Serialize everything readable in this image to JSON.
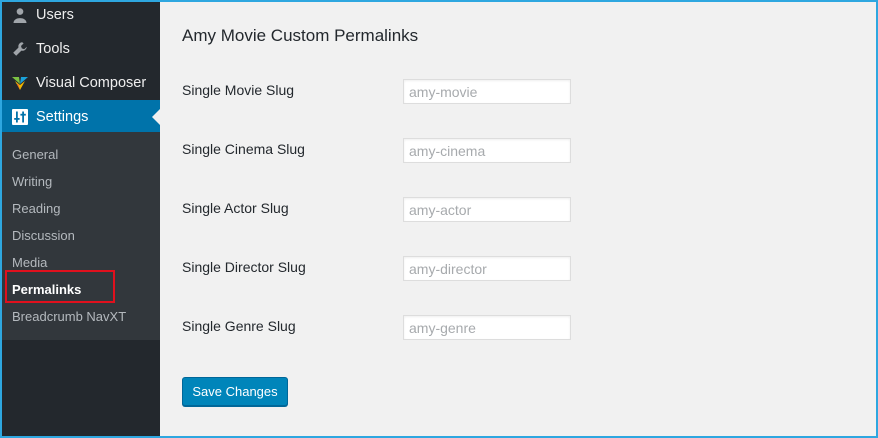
{
  "sidebar": {
    "menu": [
      {
        "label": "Users",
        "icon": "users-icon"
      },
      {
        "label": "Tools",
        "icon": "wrench-icon"
      },
      {
        "label": "Visual Composer",
        "icon": "visual-composer-icon"
      },
      {
        "label": "Settings",
        "icon": "settings-sliders-icon",
        "current": true
      }
    ],
    "submenu": [
      {
        "label": "General"
      },
      {
        "label": "Writing"
      },
      {
        "label": "Reading"
      },
      {
        "label": "Discussion"
      },
      {
        "label": "Media"
      },
      {
        "label": "Permalinks",
        "active": true
      },
      {
        "label": "Breadcrumb NavXT"
      }
    ]
  },
  "main": {
    "title": "Amy Movie Custom Permalinks",
    "fields": [
      {
        "label": "Single Movie Slug",
        "placeholder": "amy-movie",
        "value": ""
      },
      {
        "label": "Single Cinema Slug",
        "placeholder": "amy-cinema",
        "value": ""
      },
      {
        "label": "Single Actor Slug",
        "placeholder": "amy-actor",
        "value": ""
      },
      {
        "label": "Single Director Slug",
        "placeholder": "amy-director",
        "value": ""
      },
      {
        "label": "Single Genre Slug",
        "placeholder": "amy-genre",
        "value": ""
      }
    ],
    "save_label": "Save Changes"
  },
  "colors": {
    "frame_border": "#2ea7e0",
    "sidebar_bg": "#23282d",
    "submenu_bg": "#32373c",
    "current_menu_bg": "#0073aa",
    "highlight_box": "#e0101d",
    "button_bg": "#0085ba",
    "content_bg": "#f1f1f1"
  }
}
